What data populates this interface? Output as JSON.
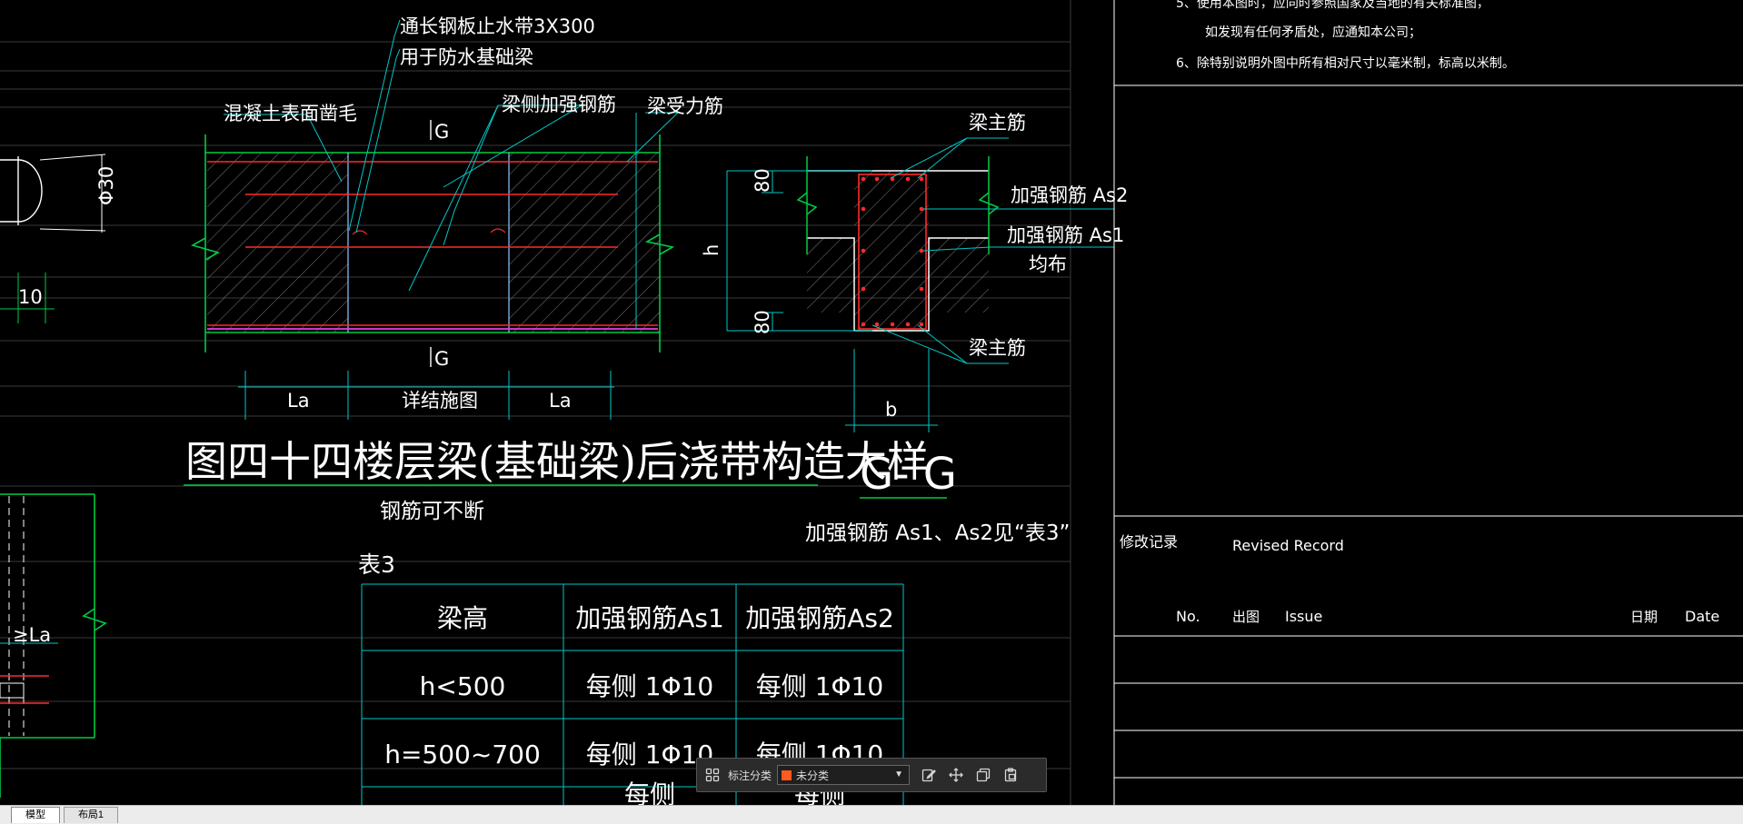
{
  "drawing": {
    "callouts": {
      "waterstop": "通长钢板止水带3X300",
      "waterstop_use": "用于防水基础梁",
      "roughen": "混凝土表面凿毛",
      "side_rebar": "梁侧加强钢筋",
      "stress_rebar": "梁受力筋",
      "section_mark": "G",
      "diameter": "Φ30",
      "dim_10": "10",
      "la_left": "La",
      "la_right": "La",
      "see_plan": "详结施图",
      "la_bottom": "≥La",
      "main_rebar_top": "梁主筋",
      "main_rebar_bottom": "梁主筋",
      "as2": "加强钢筋 As2",
      "as1": "加强钢筋 As1",
      "even": "均布",
      "dim_80_top": "80",
      "dim_80_bottom": "80",
      "dim_h": "h",
      "dim_b": "b"
    },
    "title": "图四十四楼层梁(基础梁)后浇带构造大样",
    "section_title": "G- G",
    "rebar_continuous": "钢筋可不断",
    "rebar_note": "加强钢筋 As1、As2见“表3”",
    "table_label": "表3",
    "table": {
      "headers": [
        "梁高",
        "加强钢筋As1",
        "加强钢筋As2"
      ],
      "rows": [
        [
          "h<500",
          "每侧  1Φ10",
          "每侧  1Φ10"
        ],
        [
          "h=500~700",
          "每侧  1Φ10",
          "每侧  1Φ10"
        ],
        [
          "",
          "每侧",
          "每侧"
        ]
      ]
    }
  },
  "title_block": {
    "notes": [
      "5、使用本图时，应同时参照国家及当地的有关标准图，",
      "如发现有任何矛盾处，应通知本公司；",
      "6、除特别说明外图中所有相对尺寸以毫米制，标高以米制。"
    ],
    "revision_cn": "修改记录",
    "revision_en": "Revised Record",
    "col_no": "No.",
    "col_issue_cn": "出图",
    "col_issue_en": "Issue",
    "col_date_cn": "日期",
    "col_date_en": "Date"
  },
  "toolbar": {
    "label": "标注分类",
    "selected": "未分类",
    "selected_color": "#ff5a1f"
  },
  "tabs": [
    "模型",
    "布局1"
  ],
  "colors": {
    "background": "#000000",
    "concrete_line": "#00cc44",
    "rebar": "#ff2a2a",
    "leader": "#00c8c8",
    "waterstop": "#e040e0",
    "text": "#ffffff"
  }
}
